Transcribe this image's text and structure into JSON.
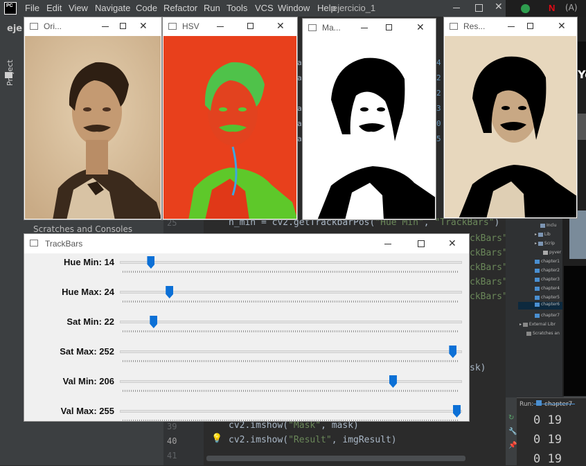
{
  "ide": {
    "menu": [
      "File",
      "Edit",
      "View",
      "Navigate",
      "Code",
      "Refactor",
      "Run",
      "Tools",
      "VCS",
      "Window",
      "Help"
    ],
    "project_name": "ejercicio_1",
    "breadcrumb": "eje",
    "project_tab": "Project",
    "scratches": "Scratches and Consoles",
    "line_numbers": [
      "25",
      "39",
      "40",
      "41"
    ],
    "code_lines": {
      "l25_a": "h_min = cv2.getTrackbarPos(",
      "l25_b": "\"Hue Min\"",
      "l25_c": ", ",
      "l25_d": "\"TrackBars\"",
      "l25_e": ")",
      "l39_a": "cv2.imshow(",
      "l39_b": "\"Mask\"",
      "l39_c": ", mask)",
      "l40_a": "cv2.imshow(",
      "l40_b": "\"Result\"",
      "l40_c": ", imgResult)"
    },
    "right_fragments": [
      "ckBars\")",
      "ckBars\")",
      "ckBars\")",
      "ckBars\")",
      "ckBars\")",
      "sk)"
    ],
    "left_fragments": [
      "ar",
      "ar",
      "ar",
      "ar",
      "ar"
    ],
    "digits_fragments": [
      "4",
      "2",
      "2",
      "0",
      "5",
      "3"
    ],
    "tree": [
      "Inclu",
      "Lib",
      "Scrip",
      "pyver",
      "chapter1",
      "chapter2",
      "chapter3",
      "chapter4",
      "chapter5",
      "chapter6",
      "chapter7",
      "External Libr",
      "Scratches an"
    ],
    "run_label": "Run:",
    "run_tab": "chapter7",
    "run_output": [
      "0 19",
      "0 19",
      "0 19"
    ]
  },
  "windows": {
    "original": {
      "title": "Ori..."
    },
    "hsv": {
      "title": "HSV"
    },
    "mask": {
      "title": "Ma..."
    },
    "result": {
      "title": "Res..."
    },
    "trackbars": {
      "title": "TrackBars"
    }
  },
  "trackbars": [
    {
      "label": "Hue Min: 14",
      "value": 14,
      "max": 179
    },
    {
      "label": "Hue Max: 24",
      "value": 24,
      "max": 179
    },
    {
      "label": "Sat Min: 22",
      "value": 22,
      "max": 255
    },
    {
      "label": "Sat Max: 252",
      "value": 252,
      "max": 255
    },
    {
      "label": "Val Min: 206",
      "value": 206,
      "max": 255
    },
    {
      "label": "Val Max: 255",
      "value": 255,
      "max": 255
    }
  ],
  "colors": {
    "ide_bg": "#2b2b2b",
    "ide_panel": "#3c3f41",
    "thumb": "#0c70d6",
    "hsv_red": "#e8401c",
    "hsv_green": "#5ec82a",
    "sepia": "#c9ab86"
  }
}
